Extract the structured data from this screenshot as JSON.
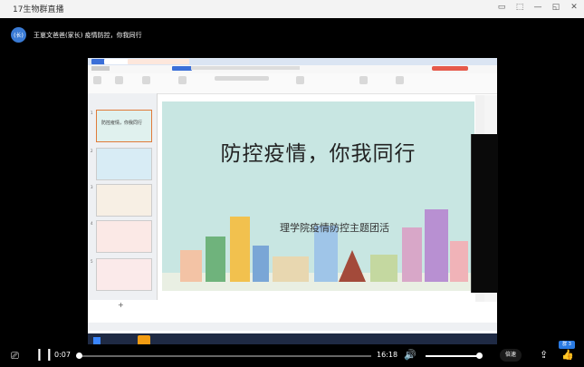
{
  "window": {
    "title": "17生物群直播",
    "controls": [
      "▭",
      "⬚",
      "—",
      "◱",
      "✕"
    ]
  },
  "presenter": {
    "avatar_text": "(长)",
    "name": "王崽文爸爸(家长) 疫情防控，你我同行"
  },
  "slide": {
    "title": "防控疫情，你我同行",
    "subtitle": "理学院疫情防控主题团活"
  },
  "thumbnails": [
    {
      "num": "1",
      "text": "防控疫情，你我同行"
    },
    {
      "num": "2",
      "text": ""
    },
    {
      "num": "3",
      "text": ""
    },
    {
      "num": "4",
      "text": ""
    },
    {
      "num": "5",
      "text": ""
    }
  ],
  "player": {
    "current_time": "0:07",
    "total_time": "16:18",
    "speed_label": "倍速",
    "progress": 0.007,
    "volume": 1.0
  },
  "badge": "群 3",
  "colors": {
    "accent": "#2a7ae2",
    "background": "#000000",
    "slide_bg": "#c8e6e2"
  }
}
